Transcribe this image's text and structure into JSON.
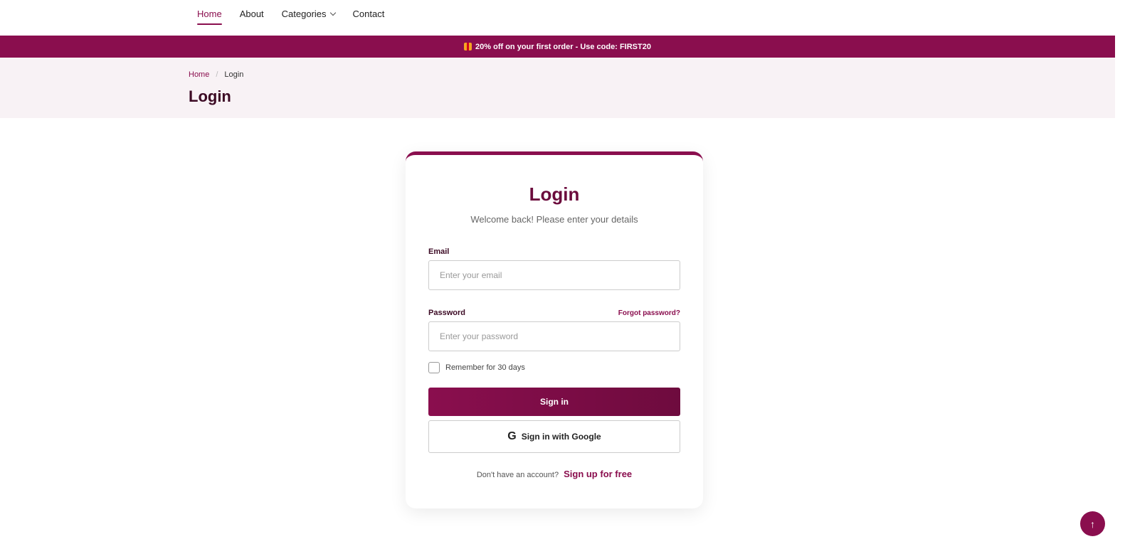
{
  "nav": {
    "items": [
      {
        "label": "Home",
        "active": true
      },
      {
        "label": "About"
      },
      {
        "label": "Categories",
        "has_dropdown": true
      },
      {
        "label": "Contact"
      }
    ]
  },
  "promo": {
    "icon": "gift-icon",
    "text": "20% off on your first order - Use code: FIRST20"
  },
  "breadcrumb": {
    "home": "Home",
    "separator": "/",
    "current": "Login"
  },
  "page_title": "Login",
  "login_card": {
    "title": "Login",
    "subtitle": "Welcome back! Please enter your details",
    "email": {
      "label": "Email",
      "placeholder": "Enter your email",
      "value": ""
    },
    "password": {
      "label": "Password",
      "placeholder": "Enter your password",
      "value": "",
      "forgot_label": "Forgot password?"
    },
    "remember": {
      "label": "Remember for 30 days",
      "checked": false
    },
    "signin_label": "Sign in",
    "google_label": "Sign in with Google",
    "google_icon": "google-g-icon",
    "signup_prompt": "Don't have an account?",
    "signup_link": "Sign up for free"
  },
  "scroll_top": {
    "icon": "arrow-up-icon",
    "glyph": "↑"
  },
  "colors": {
    "brand": "#8a0e4e",
    "title_dark": "#3c0a24",
    "header_bg": "#f8f2f5"
  }
}
